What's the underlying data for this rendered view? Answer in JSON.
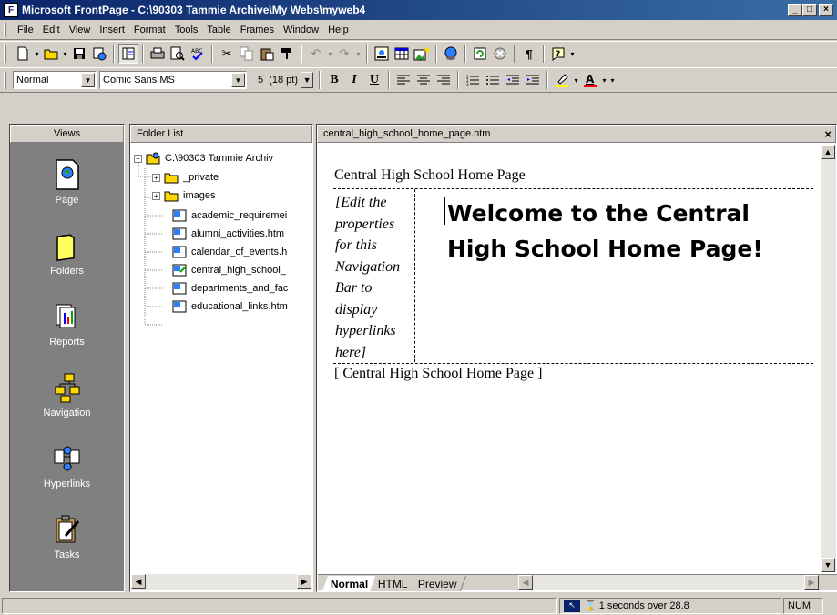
{
  "window": {
    "title": "Microsoft FrontPage - C:\\90303 Tammie Archive\\My Webs\\myweb4"
  },
  "menu": [
    "File",
    "Edit",
    "View",
    "Insert",
    "Format",
    "Tools",
    "Table",
    "Frames",
    "Window",
    "Help"
  ],
  "format_bar": {
    "style": "Normal",
    "font": "Comic Sans MS",
    "size": "5  (18 pt)",
    "bold": "B",
    "italic": "I",
    "underline": "U"
  },
  "views": {
    "header": "Views",
    "items": [
      "Page",
      "Folders",
      "Reports",
      "Navigation",
      "Hyperlinks",
      "Tasks"
    ]
  },
  "folder_list": {
    "header": "Folder List",
    "root": "C:\\90303 Tammie Archiv",
    "folders": [
      "_private",
      "images"
    ],
    "files": [
      "academic_requiremei",
      "alumni_activities.htm",
      "calendar_of_events.h",
      "central_high_school_",
      "departments_and_fac",
      "educational_links.htm"
    ]
  },
  "editor": {
    "tab_title": "central_high_school_home_page.htm",
    "close": "×",
    "page_banner": "Central High School Home Page",
    "nav_placeholder": [
      "[Edit the",
      "properties",
      "for this",
      "Navigation",
      "Bar to",
      "display",
      "hyperlinks",
      "here]"
    ],
    "heading_lines": [
      "Welcome to the Central",
      "High School Home Page!"
    ],
    "footer_nav": "[ Central High School Home Page ]",
    "tabs": [
      "Normal",
      "HTML",
      "Preview"
    ]
  },
  "status": {
    "download_time": "1 seconds over 28.8",
    "num": "NUM"
  }
}
